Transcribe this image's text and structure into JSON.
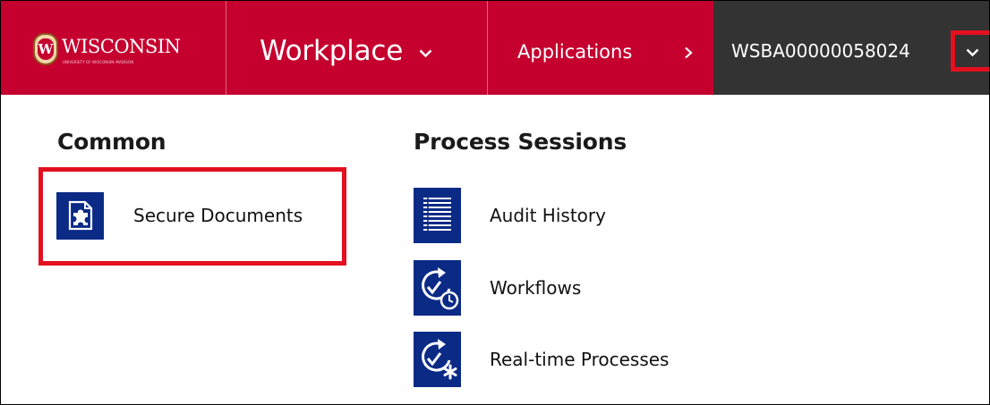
{
  "brand": {
    "crest_letter": "W",
    "name": "WISCONSIN",
    "subtitle": "UNIVERSITY OF WISCONSIN–MADISON",
    "primary_color": "#c5002f",
    "dark_color": "#333333",
    "tile_color": "#0a2a86",
    "highlight_color": "#e3101f"
  },
  "nav": {
    "workplace_label": "Workplace",
    "applications_label": "Applications",
    "record_id": "WSBA00000058024"
  },
  "menu": {
    "common": {
      "heading": "Common",
      "items": [
        {
          "label": "Secure Documents",
          "icon": "puzzle-document-icon"
        }
      ]
    },
    "process_sessions": {
      "heading": "Process Sessions",
      "items": [
        {
          "label": "Audit History",
          "icon": "list-lines-icon"
        },
        {
          "label": "Workflows",
          "icon": "workflow-clock-icon"
        },
        {
          "label": "Real-time Processes",
          "icon": "realtime-asterisk-icon"
        }
      ]
    }
  }
}
